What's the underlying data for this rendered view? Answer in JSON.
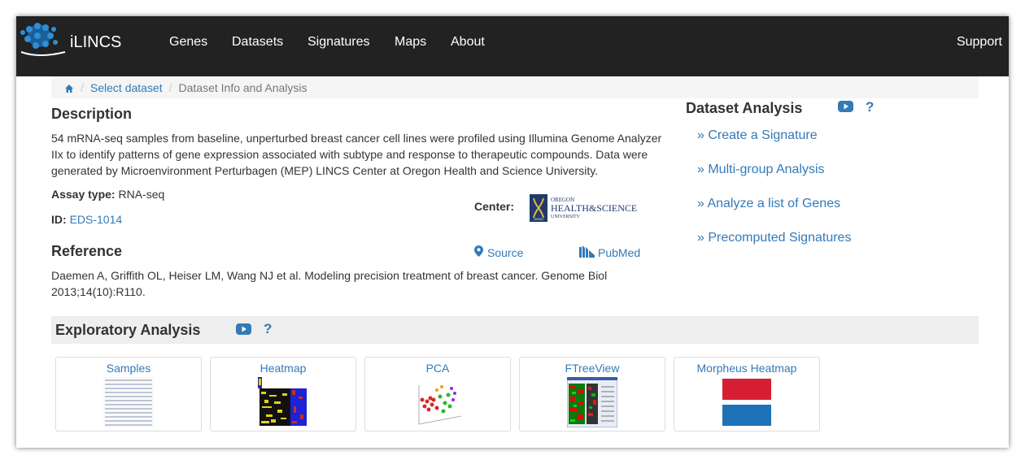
{
  "navbar": {
    "brand": "iLINCS",
    "links": [
      "Genes",
      "Datasets",
      "Signatures",
      "Maps",
      "About"
    ],
    "support": "Support"
  },
  "breadcrumb": {
    "items": [
      "Select dataset",
      "Dataset Info and Analysis"
    ]
  },
  "description": {
    "title": "Description",
    "text": "54 mRNA-seq samples from baseline, unperturbed breast cancer cell lines were profiled using Illumina Genome Analyzer IIx to identify patterns of gene expression associated with subtype and response to therapeutic compounds. Data were generated by Microenvironment Perturbagen (MEP) LINCS Center at Oregon Health and Science University.",
    "assay_label": "Assay type:",
    "assay_value": "RNA-seq",
    "id_label": "ID:",
    "id_value": "EDS-1014",
    "center_label": "Center:",
    "center_logo": {
      "line1": "OREGON",
      "line2": "HEALTH&SCIENCE",
      "line3": "UNIVERSITY",
      "badge": "OHSU"
    }
  },
  "reference": {
    "title": "Reference",
    "source_label": "Source",
    "pubmed_label": "PubMed",
    "text": "Daemen A, Griffith OL, Heiser LM, Wang NJ et al. Modeling precision treatment of breast cancer. Genome Biol 2013;14(10):R110."
  },
  "dataset_analysis": {
    "title": "Dataset Analysis",
    "help": "?",
    "links": [
      "» Create a Signature",
      "» Multi-group Analysis",
      "» Analyze a list of Genes",
      "» Precomputed Signatures"
    ]
  },
  "exploratory": {
    "title": "Exploratory Analysis",
    "help": "?",
    "cards": [
      "Samples",
      "Heatmap",
      "PCA",
      "FTreeView",
      "Morpheus Heatmap"
    ]
  },
  "colors": {
    "navbar_bg": "#222222",
    "link": "#337ab7",
    "youtube": "#337ab7",
    "morpheus_red": "#d61f35",
    "morpheus_blue": "#1e73b8"
  }
}
